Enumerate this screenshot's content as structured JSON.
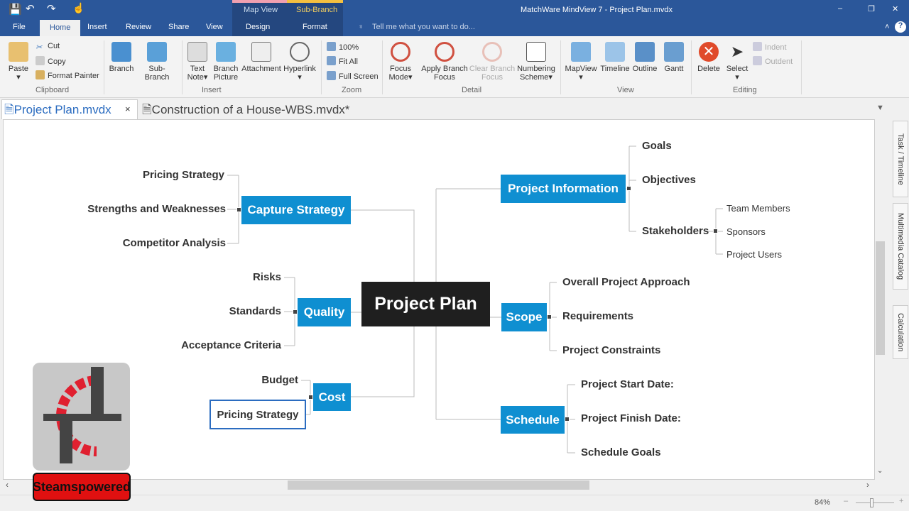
{
  "window": {
    "title": "MatchWare MindView 7 - Project Plan.mvdx",
    "minimize": "–",
    "restore": "❐",
    "close": "✕"
  },
  "context_tabs": {
    "map_view": "Map View",
    "sub_branch": "Sub-Branch",
    "design": "Design",
    "format": "Format"
  },
  "ribbon_tabs": [
    "File",
    "Home",
    "Insert",
    "Review",
    "Share",
    "View"
  ],
  "tell_me": "Tell me what you want to do...",
  "ribbon": {
    "clipboard": {
      "paste": "Paste",
      "cut": "Cut",
      "copy": "Copy",
      "format_painter": "Format Painter",
      "group": "Clipboard"
    },
    "insert": {
      "branch": "Branch",
      "sub_branch": "Sub-Branch",
      "text_note": "Text Note",
      "branch_picture": "Branch Picture",
      "attachment": "Attachment",
      "hyperlink": "Hyperlink",
      "group": "Insert"
    },
    "zoom": {
      "z100": "100%",
      "fit_all": "Fit All",
      "full_screen": "Full Screen",
      "group": "Zoom"
    },
    "detail": {
      "focus_mode": "Focus Mode",
      "apply_branch_focus": "Apply Branch Focus",
      "clear_branch_focus": "Clear Branch Focus",
      "numbering_scheme": "Numbering Scheme",
      "group": "Detail"
    },
    "view": {
      "mapview": "MapView",
      "timeline": "Timeline",
      "outline": "Outline",
      "gantt": "Gantt",
      "group": "View"
    },
    "editing": {
      "delete": "Delete",
      "select": "Select",
      "indent": "Indent",
      "outdent": "Outdent",
      "group": "Editing"
    }
  },
  "doc_tabs": [
    {
      "label": "Project Plan.mvdx",
      "active": true
    },
    {
      "label": "Construction of a House-WBS.mvdx*",
      "active": false
    }
  ],
  "side_tabs": [
    "Task / Timeline",
    "Multimedia Catalog",
    "Calculation"
  ],
  "map": {
    "center": "Project Plan",
    "project_information": {
      "label": "Project Information",
      "children": [
        "Goals",
        "Objectives",
        "Stakeholders"
      ],
      "stakeholders": [
        "Team Members",
        "Sponsors",
        "Project Users"
      ]
    },
    "capture_strategy": {
      "label": "Capture Strategy",
      "children": [
        "Pricing Strategy",
        "Strengths and Weaknesses",
        "Competitor Analysis"
      ]
    },
    "quality": {
      "label": "Quality",
      "children": [
        "Risks",
        "Standards",
        "Acceptance Criteria"
      ]
    },
    "scope": {
      "label": "Scope",
      "children": [
        "Overall Project Approach",
        "Requirements",
        "Project Constraints"
      ]
    },
    "cost": {
      "label": "Cost",
      "children": [
        "Budget",
        "Pricing Strategy"
      ]
    },
    "schedule": {
      "label": "Schedule",
      "children": [
        "Project Start Date:",
        "Project Finish Date:",
        "Schedule Goals"
      ]
    }
  },
  "status": {
    "zoom": "84%",
    "zoom_level_percent": 84
  },
  "watermark": {
    "text": "Steamspowered"
  },
  "colors": {
    "title_bar": "#2b579a",
    "branch": "#0f8fd1",
    "center": "#1f1f1f"
  }
}
